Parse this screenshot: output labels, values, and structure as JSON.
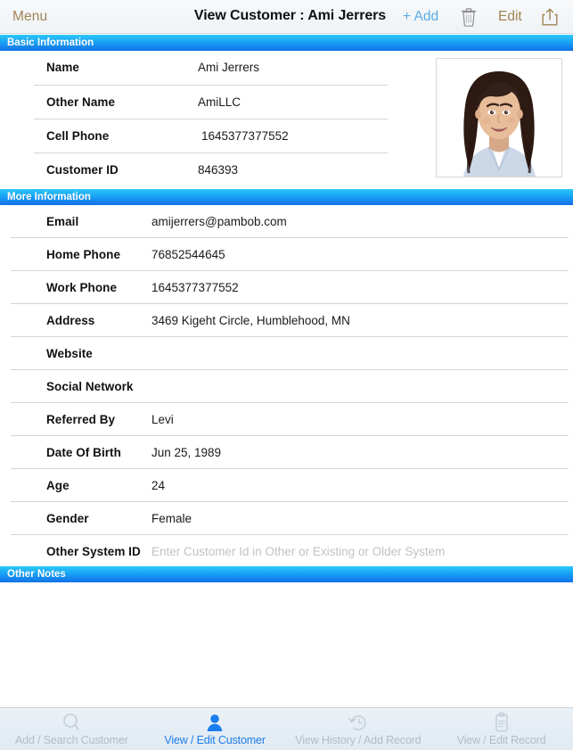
{
  "topbar": {
    "menu_label": "Menu",
    "title": "View Customer : Ami Jerrers",
    "add_label": "+ Add",
    "edit_label": "Edit",
    "trash_icon": "trash-icon",
    "share_icon": "share-icon",
    "accent_brown": "#a08455",
    "accent_blue": "#5aabe8"
  },
  "sections": {
    "basic": {
      "title": "Basic Information",
      "rows": [
        {
          "label": "Name",
          "value": "Ami Jerrers",
          "indent": false
        },
        {
          "label": "Other Name",
          "value": "AmiLLC",
          "indent": false
        },
        {
          "label": "Cell Phone",
          "value": "1645377377552",
          "indent": true
        },
        {
          "label": "Customer ID",
          "value": "846393",
          "indent": false
        }
      ]
    },
    "more": {
      "title": "More Information",
      "rows": [
        {
          "label": "Email",
          "value": "amijerrers@pambob.com",
          "placeholder": false
        },
        {
          "label": "Home Phone",
          "value": "76852544645",
          "placeholder": false
        },
        {
          "label": "Work Phone",
          "value": "1645377377552",
          "placeholder": false
        },
        {
          "label": "Address",
          "value": "3469 Kigeht Circle, Humblehood, MN",
          "placeholder": false
        },
        {
          "label": "Website",
          "value": "",
          "placeholder": false
        },
        {
          "label": "Social Network",
          "value": "",
          "placeholder": false
        },
        {
          "label": "Referred By",
          "value": "Levi",
          "placeholder": false
        },
        {
          "label": "Date Of Birth",
          "value": "Jun 25, 1989",
          "placeholder": false
        },
        {
          "label": "Age",
          "value": "24",
          "placeholder": false
        },
        {
          "label": "Gender",
          "value": "Female",
          "placeholder": false
        },
        {
          "label": "Other System ID",
          "value": "Enter Customer Id in Other or Existing or Older System",
          "placeholder": true
        }
      ]
    },
    "notes": {
      "title": "Other Notes",
      "body": ""
    }
  },
  "photo": {
    "alt": "customer-portrait"
  },
  "tabbar": {
    "active_index": 1,
    "active_color": "#1b7ef0",
    "inactive_color": "#b4bcc4",
    "tabs": [
      {
        "label": "Add / Search Customer",
        "icon": "search-icon"
      },
      {
        "label": "View / Edit Customer",
        "icon": "person-icon"
      },
      {
        "label": "View History / Add Record",
        "icon": "history-clock-icon"
      },
      {
        "label": "View / Edit Record",
        "icon": "clipboard-icon"
      }
    ]
  }
}
